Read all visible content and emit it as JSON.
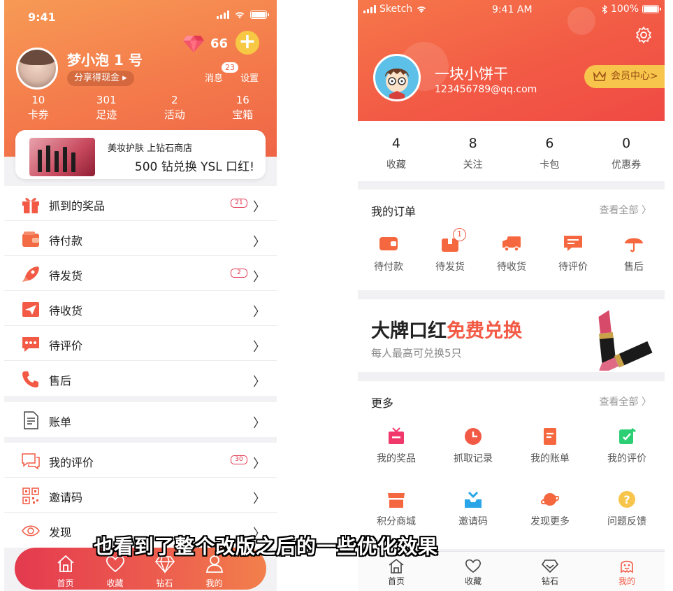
{
  "left": {
    "status": {
      "time": "9:41"
    },
    "profile": {
      "name": "梦小泡 1 号",
      "share_label": "分享得现金 ▸"
    },
    "gems": {
      "count": "66",
      "add": "+"
    },
    "header_links": {
      "messages": "消息",
      "messages_badge": "23",
      "settings": "设置"
    },
    "stats": [
      {
        "value": "10",
        "label": "卡券"
      },
      {
        "value": "301",
        "label": "足迹"
      },
      {
        "value": "2",
        "label": "活动"
      },
      {
        "value": "16",
        "label": "宝箱"
      }
    ],
    "promo": {
      "line1": "美妆护肤 上钻石商店",
      "line2": "500 钻兑换 YSL 口红!"
    },
    "menu_orders": [
      {
        "label": "抓到的奖品",
        "badge": "21",
        "icon": "gift-icon"
      },
      {
        "label": "待付款",
        "badge": "",
        "icon": "wallet-icon"
      },
      {
        "label": "待发货",
        "badge": "2",
        "icon": "rocket-icon"
      },
      {
        "label": "待收货",
        "badge": "",
        "icon": "paper-plane-icon"
      },
      {
        "label": "待评价",
        "badge": "",
        "icon": "chat-bubble-icon"
      },
      {
        "label": "售后",
        "badge": "",
        "icon": "phone-icon"
      }
    ],
    "menu_bill": [
      {
        "label": "账单",
        "badge": "",
        "icon": "document-icon"
      }
    ],
    "menu_social": [
      {
        "label": "我的评价",
        "badge": "30",
        "icon": "comments-icon"
      },
      {
        "label": "邀请码",
        "badge": "",
        "icon": "qr-code-icon"
      },
      {
        "label": "发现",
        "badge": "",
        "icon": "eye-icon"
      }
    ],
    "tabs": [
      {
        "label": "首页",
        "icon": "home-icon"
      },
      {
        "label": "收藏",
        "icon": "heart-icon"
      },
      {
        "label": "钻石",
        "icon": "diamond-icon"
      },
      {
        "label": "我的",
        "icon": "person-icon"
      }
    ]
  },
  "right": {
    "status": {
      "carrier": "Sketch",
      "time": "9:41 AM",
      "battery": "100%"
    },
    "profile": {
      "name": "一块小饼干",
      "email": "123456789@qq.com",
      "vip_label": "会员中心>"
    },
    "counts": [
      {
        "value": "4",
        "label": "收藏"
      },
      {
        "value": "8",
        "label": "关注"
      },
      {
        "value": "6",
        "label": "卡包"
      },
      {
        "value": "0",
        "label": "优惠券"
      }
    ],
    "orders": {
      "title": "我的订单",
      "view_all": "查看全部 〉",
      "items": [
        {
          "label": "待付款",
          "icon": "wallet-icon",
          "badge": ""
        },
        {
          "label": "待发货",
          "icon": "package-icon",
          "badge": "1"
        },
        {
          "label": "待收货",
          "icon": "truck-icon",
          "badge": ""
        },
        {
          "label": "待评价",
          "icon": "comment-icon",
          "badge": ""
        },
        {
          "label": "售后",
          "icon": "umbrella-icon",
          "badge": ""
        }
      ]
    },
    "banner": {
      "title_main": "大牌口红",
      "title_accent": "免费兑换",
      "subtitle": "每人最高可兑换5只"
    },
    "more": {
      "title": "更多",
      "view_all": "查看全部 〉",
      "items": [
        {
          "label": "我的奖品",
          "icon": "gift-icon",
          "color": "#f0386b"
        },
        {
          "label": "抓取记录",
          "icon": "clock-icon",
          "color": "#f25a45"
        },
        {
          "label": "我的账单",
          "icon": "bill-icon",
          "color": "#f5683f"
        },
        {
          "label": "我的评价",
          "icon": "edit-icon",
          "color": "#2ccf74"
        },
        {
          "label": "积分商城",
          "icon": "shop-icon",
          "color": "#f5683f"
        },
        {
          "label": "邀请码",
          "icon": "inbox-icon",
          "color": "#2aa6e8"
        },
        {
          "label": "发现更多",
          "icon": "planet-icon",
          "color": "#f5683f"
        },
        {
          "label": "问题反馈",
          "icon": "question-icon",
          "color": "#f7c54b"
        }
      ]
    },
    "tabs": [
      {
        "label": "首页",
        "icon": "home-icon",
        "active": false
      },
      {
        "label": "收藏",
        "icon": "heart-icon",
        "active": false
      },
      {
        "label": "钻石",
        "icon": "diamond-icon",
        "active": false
      },
      {
        "label": "我的",
        "icon": "ghost-icon",
        "active": true
      }
    ]
  },
  "subtitle": "也看到了整个改版之后的一些优化效果",
  "colors": {
    "left_accent": "#ef6547",
    "right_accent": "#f25a45",
    "badge_red": "#e0334e",
    "vip_gold": "#f7c54b"
  }
}
